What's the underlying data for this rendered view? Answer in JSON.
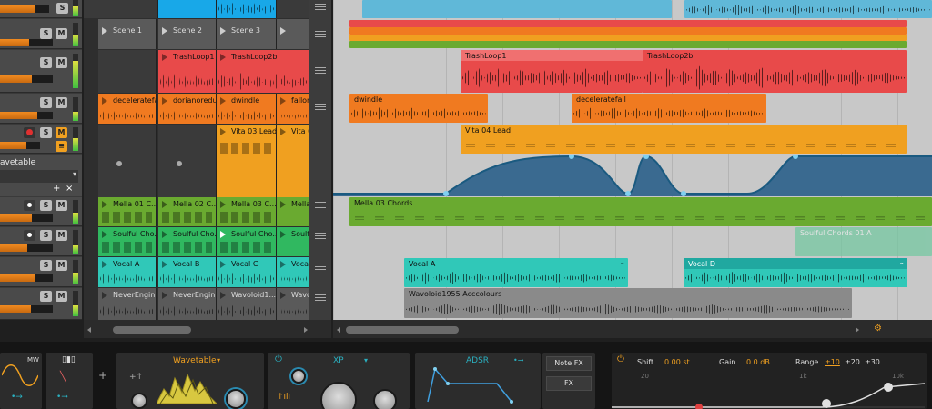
{
  "mixer": {
    "buttons": {
      "solo": "S",
      "mute": "M"
    },
    "wavetable_track": {
      "name": "avetable",
      "menu_plus": "+",
      "menu_x": "×"
    }
  },
  "launcher": {
    "scenes": [
      "Scene 1",
      "Scene 2",
      "Scene 3"
    ],
    "row_trash": [
      "TrashLoop1",
      "TrashLoop2b"
    ],
    "row_orange": [
      "deceleratefall",
      "dorianoredu...",
      "dwindle",
      "fallon"
    ],
    "row_vita": [
      "Vita 03 Lead",
      "Vita 0"
    ],
    "row_mella": [
      "Mella 01 C...",
      "Mella 02 C...",
      "Mella 03 C...",
      "Mella 0"
    ],
    "row_soulful": [
      "Soulful Cho...",
      "Soulful Cho...",
      "Soulful Cho...",
      "Soulful C"
    ],
    "row_vocal": [
      "Vocal A",
      "Vocal B",
      "Vocal C",
      "Vocal"
    ],
    "row_never": [
      "NeverEngin...",
      "NeverEngin...",
      "Wavoloid1...",
      "Wavolo"
    ]
  },
  "arranger": {
    "clips": {
      "trash1": "TrashLoop1",
      "trash2": "TrashLoop2b",
      "dwindle": "dwindle",
      "decel": "deceleratefall",
      "vita": "Vita 04 Lead",
      "mella": "Mella 03 Chords",
      "soulful": "Soulful Chords 01 A",
      "vocal_a": "Vocal A",
      "vocal_d": "Vocal D",
      "wavoloid": "Wavoloid1955 Acccolours"
    }
  },
  "devices": {
    "lfo_label": "MW",
    "wavetable_title": "Wavetable",
    "osc_title": "XP",
    "adsr_title": "ADSR",
    "note_fx": "Note FX",
    "fx": "FX",
    "plus": "+",
    "eq": {
      "shift_label": "Shift",
      "shift_value": "0.00 st",
      "gain_label": "Gain",
      "gain_value": "0.0 dB",
      "range_label": "Range",
      "range_options": [
        "±10",
        "±20",
        "±30"
      ],
      "scale_20": "20",
      "scale_1k": "1k",
      "scale_10k": "10k"
    }
  },
  "colors": {
    "red": "#e84a4a",
    "orange": "#f07a20",
    "amber": "#f0a020",
    "green": "#6aaa30",
    "teal": "#30c0a0",
    "cyan": "#30c8c8",
    "grey": "#8a8a8a",
    "blue": "#2a8ab0"
  }
}
